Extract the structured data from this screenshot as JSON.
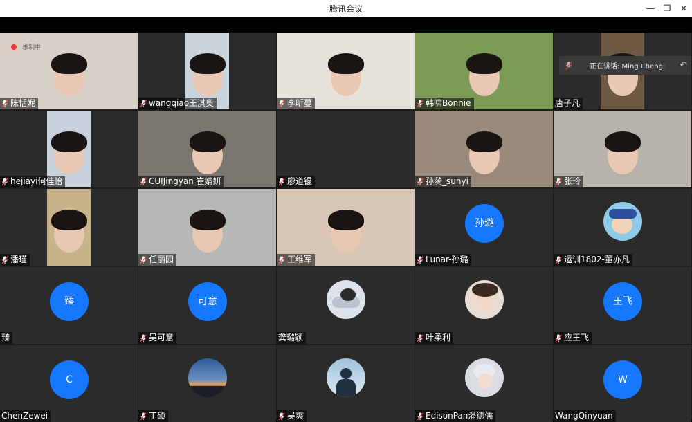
{
  "window": {
    "title": "腾讯会议",
    "min": "—",
    "restore": "❐",
    "close": "✕"
  },
  "recording": {
    "label": "录制中"
  },
  "speaking": {
    "label": "正在讲话: Ming Cheng;"
  },
  "participants": [
    {
      "name": "陈恬妮",
      "type": "video",
      "bg": "#d8cfc6"
    },
    {
      "name": "wangqiao王淇奥",
      "type": "video",
      "bg": "#c9d3dc"
    },
    {
      "name": "李昕蔓",
      "type": "video",
      "bg": "#e6e1da"
    },
    {
      "name": "韩啸Bonnie",
      "type": "video",
      "bg": "#7a9a55"
    },
    {
      "name": "唐子凡",
      "type": "video",
      "bg": "#6e5a44"
    },
    {
      "name": "hejiayi何佳怡",
      "type": "video",
      "bg": "#c7d0db"
    },
    {
      "name": "CUIJingyan 崔婧妍",
      "type": "video",
      "bg": "#7b756f"
    },
    {
      "name": "廖道锟",
      "type": "empty",
      "bg": "#2b2b2b"
    },
    {
      "name": "孙漪_sunyi",
      "type": "video",
      "bg": "#9a8a7c"
    },
    {
      "name": "张玲",
      "type": "video",
      "bg": "#b7b2aa"
    },
    {
      "name": "潘瑾",
      "type": "video",
      "bg": "#c8b48a"
    },
    {
      "name": "任丽园",
      "type": "video",
      "bg": "#b6b8b5"
    },
    {
      "name": "王维军",
      "type": "video",
      "bg": "#d9c6b5"
    },
    {
      "name": "Lunar-孙璐",
      "type": "avatar",
      "initials": "孙璐"
    },
    {
      "name": "运训1802-董亦凡",
      "type": "image",
      "img": "cartoon"
    },
    {
      "name": "臻",
      "type": "avatar",
      "initials": "臻"
    },
    {
      "name": "吴可意",
      "type": "avatar",
      "initials": "可意"
    },
    {
      "name": "龚璐颖",
      "type": "image",
      "img": "sleeping"
    },
    {
      "name": "叶柔利",
      "type": "image",
      "img": "doll"
    },
    {
      "name": "应王飞",
      "type": "avatar",
      "initials": "王飞"
    },
    {
      "name": "ChenZewei",
      "type": "avatar",
      "initials": "C"
    },
    {
      "name": "丁硕",
      "type": "image",
      "img": "sunset"
    },
    {
      "name": "吴爽",
      "type": "image",
      "img": "silhouette"
    },
    {
      "name": "EdisonPan潘德儒",
      "type": "image",
      "img": "anime"
    },
    {
      "name": "WangQinyuan",
      "type": "avatar",
      "initials": "W"
    }
  ],
  "muted_flags": [
    true,
    true,
    true,
    true,
    false,
    true,
    true,
    true,
    true,
    true,
    true,
    true,
    true,
    true,
    true,
    false,
    true,
    false,
    true,
    true,
    false,
    true,
    true,
    true,
    false
  ]
}
